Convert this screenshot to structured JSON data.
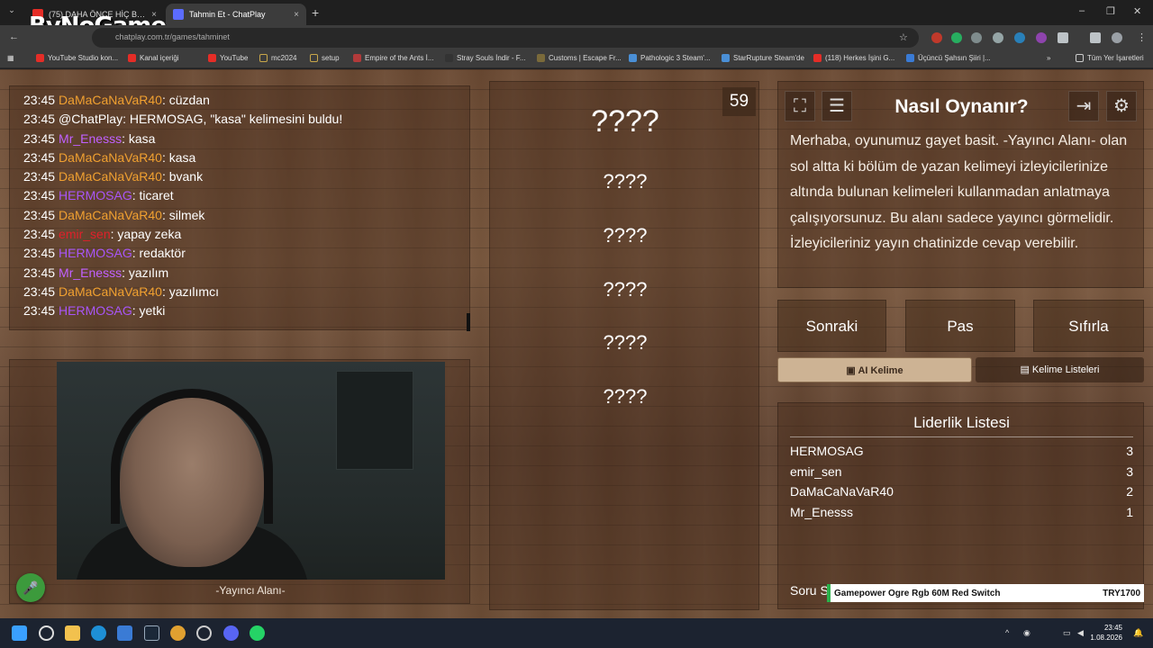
{
  "logo": "ByNoGame",
  "tabs": [
    {
      "label": "(75) DAHA ÖNCE HİÇ BU KADAR",
      "close": "×",
      "color": "#e52d27"
    },
    {
      "label": "Tahmin Et - ChatPlay",
      "close": "×",
      "color": "#5b6cff"
    }
  ],
  "new_tab": "+",
  "window_controls": {
    "minimize": "–",
    "maximize": "❐",
    "close": "✕"
  },
  "url": "chatplay.com.tr/games/tahminet",
  "bookmarks": [
    {
      "label": "YouTube Studio kon...",
      "color": "#e52d27"
    },
    {
      "label": "Kanal içeriği",
      "color": "#e52d27"
    },
    {
      "label": "YouTube",
      "color": "#e52d27"
    },
    {
      "label": "mc2024",
      "color": "#c9a74a"
    },
    {
      "label": "setup",
      "color": "#c9a74a"
    },
    {
      "label": "Empire of the Ants İ...",
      "color": "#b23a3a"
    },
    {
      "label": "Stray Souls İndir - F...",
      "color": "#333333"
    },
    {
      "label": "Customs | Escape Fr...",
      "color": "#7a6a3a"
    },
    {
      "label": "Pathologic 3 Steam'...",
      "color": "#4a8fd6"
    },
    {
      "label": "StarRupture Steam'de",
      "color": "#4a8fd6"
    },
    {
      "label": "(118) Herkes İşini G...",
      "color": "#e52d27"
    },
    {
      "label": "Üçüncü Şahsın Şiiri |...",
      "color": "#3a7bd5"
    }
  ],
  "bookmarks_more": "»",
  "all_bookmarks": "Tüm Yer İşaretleri",
  "chat": [
    {
      "time": "23:45",
      "user": "DaMaCaNaVaR40",
      "color": "#f0a030",
      "msg": ": cüzdan"
    },
    {
      "time": "23:45",
      "user": "@ChatPlay",
      "color": "#ffffff",
      "msg": ": HERMOSAG, \"kasa\" kelimesini buldu!"
    },
    {
      "time": "23:45",
      "user": "Mr_Enesss",
      "color": "#c060ff",
      "msg": ": kasa"
    },
    {
      "time": "23:45",
      "user": "DaMaCaNaVaR40",
      "color": "#f0a030",
      "msg": ": kasa"
    },
    {
      "time": "23:45",
      "user": "DaMaCaNaVaR40",
      "color": "#f0a030",
      "msg": ": bvank"
    },
    {
      "time": "23:45",
      "user": "HERMOSAG",
      "color": "#a855f7",
      "msg": ": ticaret"
    },
    {
      "time": "23:45",
      "user": "DaMaCaNaVaR40",
      "color": "#f0a030",
      "msg": ": silmek"
    },
    {
      "time": "23:45",
      "user": "emir_sen",
      "color": "#e0202a",
      "msg": ": yapay zeka"
    },
    {
      "time": "23:45",
      "user": "HERMOSAG",
      "color": "#a855f7",
      "msg": ": redaktör"
    },
    {
      "time": "23:45",
      "user": "Mr_Enesss",
      "color": "#c060ff",
      "msg": ": yazılım"
    },
    {
      "time": "23:45",
      "user": "DaMaCaNaVaR40",
      "color": "#f0a030",
      "msg": ": yazılımcı"
    },
    {
      "time": "23:45",
      "user": "HERMOSAG",
      "color": "#a855f7",
      "msg": ": yetki"
    }
  ],
  "streamer_label": "-Yayıncı Alanı-",
  "timer": "59",
  "main_word": "????",
  "forbidden_words": [
    "????",
    "????",
    "????",
    "????",
    "????"
  ],
  "howto": {
    "title": "Nasıl Oynanır?",
    "text": "Merhaba, oyunumuz gayet basit. -Yayıncı Alanı- olan sol altta ki bölüm de yazan kelimeyi izleyicilerinize altında bulunan kelimeleri kullanmadan anlatmaya çalışıyorsunuz. Bu alanı sadece yayıncı görmelidir. İzleyicileriniz yayın chatinizde cevap verebilir."
  },
  "buttons": {
    "next": "Sonraki",
    "pass": "Pas",
    "reset": "Sıfırla",
    "ai": "AI Kelime",
    "lists": "Kelime Listeleri"
  },
  "leaderboard": {
    "title": "Liderlik Listesi",
    "rows": [
      {
        "name": "HERMOSAG",
        "score": "3"
      },
      {
        "name": "emir_sen",
        "score": "3"
      },
      {
        "name": "DaMaCaNaVaR40",
        "score": "2"
      },
      {
        "name": "Mr_Enesss",
        "score": "1"
      }
    ]
  },
  "question_label": "Soru S",
  "ad_ticker": {
    "product": "Gamepower Ogre Rgb 60M Red Switch",
    "price": "TRY1700"
  },
  "clock": {
    "time": "23:45",
    "date": "1.08.2026"
  }
}
